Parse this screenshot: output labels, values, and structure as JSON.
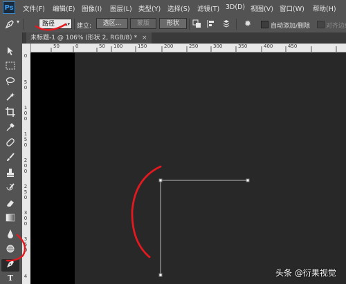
{
  "app": {
    "logo": "Ps"
  },
  "menu": [
    "文件(F)",
    "编辑(E)",
    "图像(I)",
    "图层(L)",
    "类型(Y)",
    "选择(S)",
    "滤镜(T)",
    "3D(D)",
    "视图(V)",
    "窗口(W)",
    "帮助(H)"
  ],
  "options": {
    "mode_value": "路径",
    "build_label": "建立:",
    "selection_btn": "选区...",
    "mask_btn": "蒙版",
    "shape_btn": "形状",
    "auto_add_delete": "自动添加/删除",
    "align_edges": "对齐边缘"
  },
  "document": {
    "tab_title": "未标题-1 @ 106% (形状 2, RGB/8) *",
    "close": "×"
  },
  "rulers": {
    "top": [
      "50",
      "0",
      "50",
      "100",
      "150",
      "200",
      "250",
      "300",
      "350",
      "400",
      "450"
    ],
    "left": [
      "0",
      "5",
      "0",
      "1",
      "0",
      "0",
      "1",
      "5",
      "0",
      "2",
      "0",
      "0",
      "2",
      "5",
      "0",
      "3",
      "0",
      "0",
      "3",
      "5",
      "0",
      "4"
    ]
  },
  "watermark": "头条 @衍果视觉",
  "colors": {
    "annotation": "#e3191f",
    "path": "#b8b8b8"
  },
  "icons": [
    "pen-tool-icon",
    "gear-icon",
    "move-tool-icon"
  ]
}
